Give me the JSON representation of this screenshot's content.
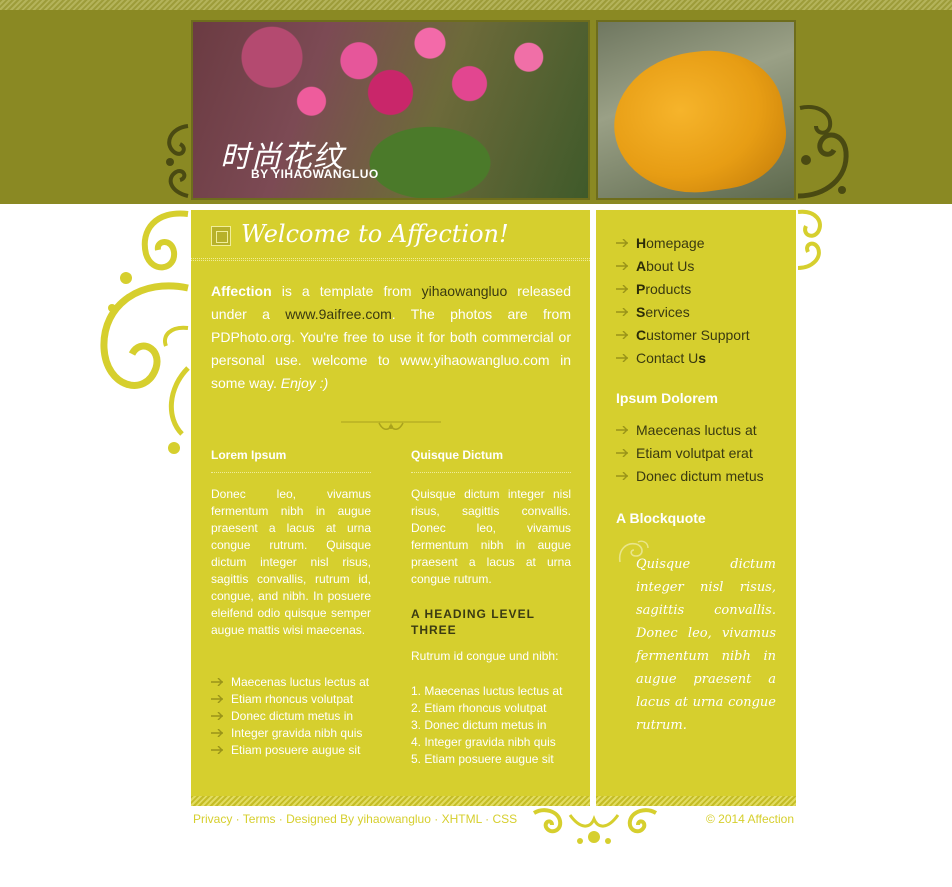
{
  "header": {
    "site_title": "时尚花纹",
    "site_subtitle": "BY YIHAOWANGLUO"
  },
  "welcome": {
    "title": "Welcome to Affection!"
  },
  "intro": {
    "brand": "Affection",
    "t1": " is a template from ",
    "link1": "yihaowangluo",
    "t2": " released under a ",
    "link2": "www.9aifree.com",
    "t3": ". The photos are from PDPhoto.org. You're free to use it for both commercial or personal use. welcome to www.yihaowangluo.com in some way. ",
    "enjoy": "Enjoy :)"
  },
  "left_column": {
    "heading": "Lorem Ipsum",
    "paragraph": "Donec leo, vivamus fermentum nibh in augue praesent a lacus at urna congue rutrum. Quisque dictum integer nisl risus, sagittis convallis, rutrum id, congue, and nibh. In posuere eleifend odio quisque semper augue mattis wisi maecenas.",
    "list": [
      "Maecenas luctus lectus at",
      "Etiam rhoncus volutpat",
      "Donec dictum metus in",
      "Integer gravida nibh quis",
      "Etiam posuere augue sit"
    ]
  },
  "right_column": {
    "heading": "Quisque Dictum",
    "paragraph": "Quisque dictum integer nisl risus, sagittis convallis. Donec leo, vivamus fermentum nibh in augue praesent a lacus at urna congue rutrum.",
    "h3": "A HEADING LEVEL THREE",
    "subtext": "Rutrum id congue und nibh:",
    "ordered": [
      "1. Maecenas luctus lectus at",
      "2. Etiam rhoncus volutpat",
      "3. Donec dictum metus in",
      "4. Integer gravida nibh quis",
      "5. Etiam posuere augue sit"
    ]
  },
  "nav": [
    {
      "first": "H",
      "rest": "omepage"
    },
    {
      "first": "A",
      "rest": "bout Us"
    },
    {
      "first": "P",
      "rest": "roducts"
    },
    {
      "first": "S",
      "rest": "ervices"
    },
    {
      "first": "C",
      "rest": "ustomer Support"
    },
    {
      "first": "",
      "rest": "Contact U",
      "last": "s"
    }
  ],
  "sidebar": {
    "ipsum_heading": "Ipsum Dolorem",
    "ipsum_list": [
      "Maecenas luctus at",
      "Etiam volutpat erat",
      "Donec dictum metus"
    ],
    "quote_heading": "A Blockquote",
    "quote": "Quisque dictum integer nisl risus, sagittis convallis. Donec leo, vivamus fermentum nibh in augue praesent a lacus at urna congue rutrum."
  },
  "footer": {
    "links": [
      "Privacy",
      "Terms",
      "Designed By yihaowangluo",
      "XHTML",
      "CSS"
    ],
    "separator": " · ",
    "copyright": "© 2014 Affection"
  },
  "colors": {
    "header_olive": "#8a8923",
    "panel_yellow": "#d6cf2e",
    "text_dark": "#3a3a10"
  }
}
